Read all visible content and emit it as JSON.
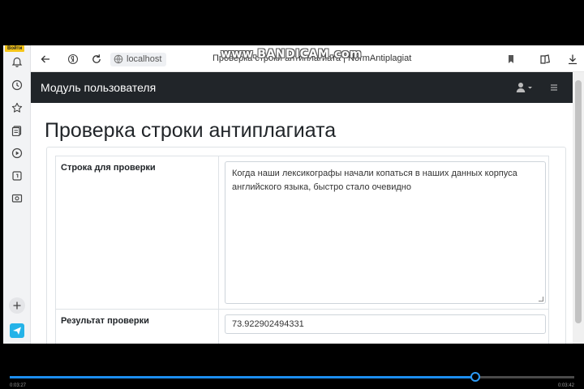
{
  "recorder": {
    "watermark": "www.BANDICAM.com"
  },
  "sidebar": {
    "login_badge": "Войти",
    "icons": [
      "bell-icon",
      "clock-icon",
      "star-icon",
      "notes-icon",
      "play-icon",
      "calendar-icon",
      "screenshot-icon"
    ],
    "add_icon": "plus-icon",
    "send_icon": "send-icon"
  },
  "addressbar": {
    "url": "localhost",
    "tab_title": "Проверка строки антиплагиата | NormAntiplagiat"
  },
  "navbar": {
    "brand": "Модуль пользователя",
    "bg_color": "#212529"
  },
  "page": {
    "heading": "Проверка строки антиплагиата",
    "check_string_label": "Строка для проверки",
    "check_string_value": "Когда наши лексикографы начали копаться в наших данных корпуса английского языка, быстро стало очевидно",
    "result_label": "Результат проверки",
    "result_value": "73.922902494331"
  },
  "player": {
    "current_time": "0:03:27",
    "total_time": "0:03:42",
    "progress": 0.824,
    "accent": "#1c8ef0"
  }
}
